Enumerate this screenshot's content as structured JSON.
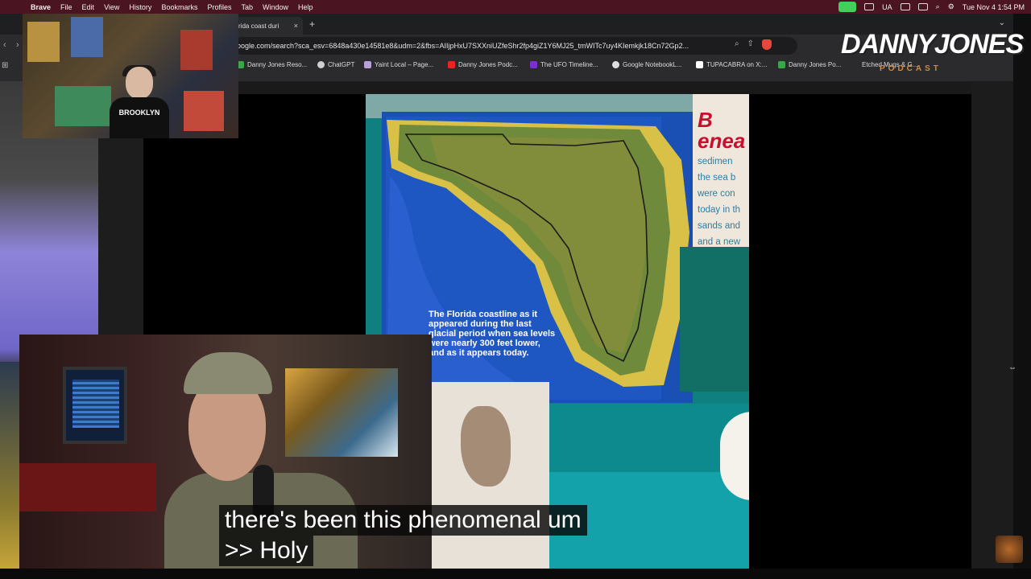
{
  "menubar": {
    "apple": "",
    "app_name": "Brave",
    "items": [
      "File",
      "Edit",
      "View",
      "History",
      "Bookmarks",
      "Profiles",
      "Tab",
      "Window",
      "Help"
    ],
    "status_text": "UA",
    "clock": "Tue Nov 4  1:54 PM"
  },
  "browser": {
    "tab_title": "rida coast duri",
    "tab_close": "×",
    "new_tab": "+",
    "tab_menu": "⌄",
    "url": "oogle.com/search?sca_esv=6848a430e14581e8&udm=2&fbs=AIIjpHxU7SXXniUZfeShr2fp4giZ1Y6MJ25_tmWITc7uy4KIemkjk18Cn72Gp2...",
    "bookmarks": [
      "Danny Jones Reso...",
      "ChatGPT",
      "Yaint Local – Page...",
      "Danny Jones Podc...",
      "The UFO Timeline...",
      "Google NotebookL...",
      "TUPACABRA on X:...",
      "Danny Jones Po...",
      "Etched Mugs & G..."
    ]
  },
  "photo": {
    "map_caption": "The Florida coastline as it appeared during the last glacial period when sea levels were nearly 300 feet lower, and as it appears today.",
    "side_text_lines": [
      "B enea",
      "sedimen",
      "the sea b",
      "were con",
      "today in th",
      "sands and",
      "and a new"
    ]
  },
  "webcam_top": {
    "shirt_text": "BROOKLYN"
  },
  "logo": {
    "wordmark": "DANNYJONES",
    "sub": "PODCAST"
  },
  "captions": {
    "line1": "there's been this phenomenal um",
    "line2": ">> Holy"
  },
  "colors": {
    "menubar": "#4a1420",
    "chrome": "#2b2b2e",
    "status_green": "#3fd15a",
    "shield": "#e8453c",
    "board_blue": "#1a4fb3",
    "teal": "#0f7f80"
  }
}
